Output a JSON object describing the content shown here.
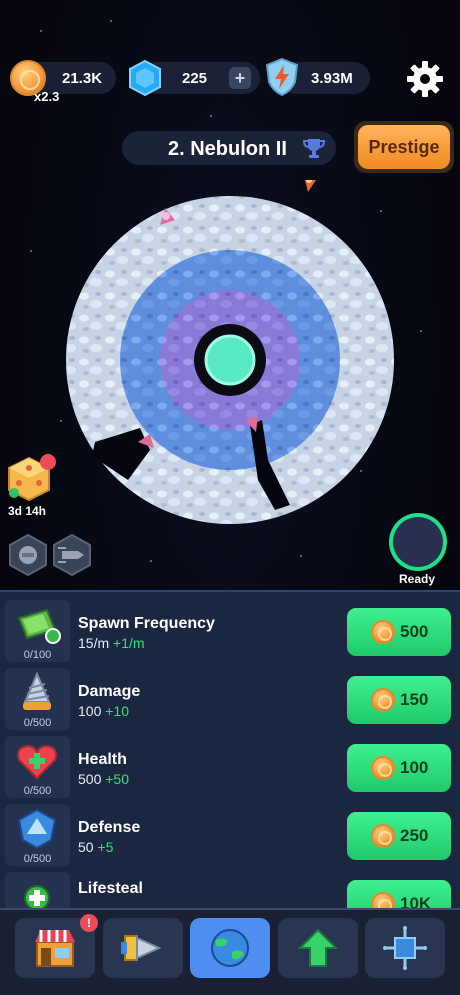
{
  "resources": {
    "coins": "21.3K",
    "coin_multiplier": "x2.3",
    "gems": "225",
    "energy": "3.93M",
    "add_gems_label": "+"
  },
  "icons": {
    "coin": "coin-icon",
    "gem": "gem-icon",
    "energy": "shield-lightning-icon",
    "settings": "gear-icon",
    "trophy": "trophy-icon"
  },
  "planet": {
    "name": "2. Nebulon II"
  },
  "prestige_label": "Prestige",
  "dice_bonus": {
    "timer": "3d 14h"
  },
  "ship_status": {
    "label": "Ready"
  },
  "upgrades": [
    {
      "title": "Spawn Frequency",
      "count": "0/100",
      "value": "15/m",
      "increment": "+1/m",
      "cost": "500",
      "icon": "spawn-frequency-icon"
    },
    {
      "title": "Damage",
      "count": "0/500",
      "value": "100",
      "increment": "+10",
      "cost": "150",
      "icon": "drill-icon"
    },
    {
      "title": "Health",
      "count": "0/500",
      "value": "500",
      "increment": "+50",
      "cost": "100",
      "icon": "heart-icon"
    },
    {
      "title": "Defense",
      "count": "0/500",
      "value": "50",
      "increment": "+5",
      "cost": "250",
      "icon": "defense-icon"
    },
    {
      "title": "Lifesteal",
      "count": "",
      "value": "",
      "increment": "",
      "cost": "10K",
      "icon": "lifesteal-icon"
    }
  ],
  "nav": {
    "items": [
      {
        "name": "shop",
        "icon": "shop-icon",
        "badge": "!"
      },
      {
        "name": "drills",
        "icon": "drill-ship-icon",
        "badge": ""
      },
      {
        "name": "planet",
        "icon": "planet-icon",
        "badge": ""
      },
      {
        "name": "upgrade",
        "icon": "up-arrow-icon",
        "badge": ""
      },
      {
        "name": "tech",
        "icon": "chip-icon",
        "badge": ""
      }
    ]
  },
  "colors": {
    "buy_button": "#2ee27a",
    "prestige": "#f5a03a",
    "active_tab": "#4e8ef0",
    "badge": "#ee4b5a"
  }
}
